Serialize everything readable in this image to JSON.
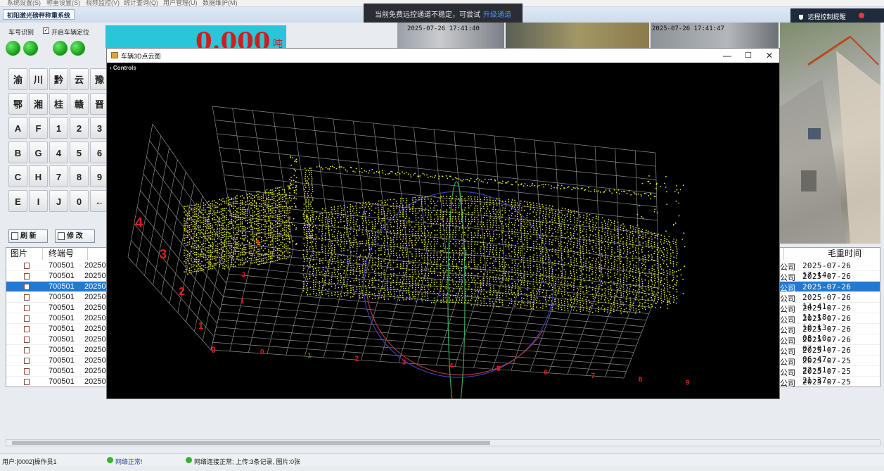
{
  "menubar": {
    "items": [
      "系统设置(S)",
      "称重设置(S)",
      "视频监控(V)",
      "统计查询(Q)",
      "用户管理(U)",
      "数据维护(M)"
    ]
  },
  "app": {
    "title": "初阳激光磅秤称重系统"
  },
  "toast": {
    "message": "当前免费远控通道不稳定，可尝试",
    "link": "升级通道"
  },
  "remote": {
    "label": "远程控制提醒"
  },
  "left": {
    "plate_label": "车号识别",
    "locate_label": "开启车辆定位",
    "weight_value": "0.000",
    "weight_unit": "吨",
    "keys": [
      [
        "渝",
        "川",
        "黔",
        "云",
        "豫"
      ],
      [
        "鄂",
        "湘",
        "桂",
        "赣",
        "晋"
      ],
      [
        "A",
        "F",
        "1",
        "2",
        "3"
      ],
      [
        "B",
        "G",
        "4",
        "5",
        "6"
      ],
      [
        "C",
        "H",
        "7",
        "8",
        "9"
      ],
      [
        "E",
        "I",
        "J",
        "0",
        "←"
      ]
    ],
    "refresh_label": "刷  新",
    "edit_label": "修  改"
  },
  "cameras": [
    {
      "timestamp": "2025-07-26  17:41:40"
    },
    {
      "timestamp": "2025-07-26  17:41:47"
    }
  ],
  "popup": {
    "title": "车辆3D点云图",
    "controls_label": "Controls",
    "minimize": "—",
    "maximize": "☐",
    "close": "✕",
    "axis_y_ticks": [
      "0",
      "1",
      "2",
      "3",
      "4"
    ],
    "axis_x_ticks": [
      "0",
      "1",
      "2",
      "3",
      "4",
      "5",
      "6",
      "7",
      "8",
      "9"
    ],
    "axis_z_ticks": [
      "1",
      "2",
      "3"
    ]
  },
  "grid": {
    "headers": [
      "图片",
      "终端号",
      "毛重时间"
    ],
    "rows": [
      {
        "terminal": "700501",
        "code": "20250",
        "company": "公司",
        "time": "2025-07-26 17:14:"
      },
      {
        "terminal": "700501",
        "code": "20250",
        "company": "公司",
        "time": "2025-07-26 16:15:"
      },
      {
        "terminal": "700501",
        "code": "20250",
        "company": "公司",
        "time": "2025-07-26 16:08:"
      },
      {
        "terminal": "700501",
        "code": "20250",
        "company": "公司",
        "time": "2025-07-26 14:41:"
      },
      {
        "terminal": "700501",
        "code": "20250",
        "company": "公司",
        "time": "2025-07-26 11:18:"
      },
      {
        "terminal": "700501",
        "code": "20250",
        "company": "公司",
        "time": "2025-07-26 10:13:"
      },
      {
        "terminal": "700501",
        "code": "20250",
        "company": "公司",
        "time": "2025-07-26 08:10:"
      },
      {
        "terminal": "700501",
        "code": "20250",
        "company": "公司",
        "time": "2025-07-26 07:01:"
      },
      {
        "terminal": "700501",
        "code": "20250",
        "company": "公司",
        "time": "2025-07-26 06:47:"
      },
      {
        "terminal": "700501",
        "code": "20250",
        "company": "公司",
        "time": "2025-07-25 22:31:"
      },
      {
        "terminal": "700501",
        "code": "20250",
        "company": "公司",
        "time": "2025-07-25 21:37:"
      },
      {
        "terminal": "700501",
        "code": "20250",
        "company": "公司",
        "time": "2025-07-25 21:27:"
      }
    ],
    "selected_index": 2
  },
  "status": {
    "user": "用户:[0002]操作员1",
    "network": "网络正常!",
    "connection": "网络连接正常; 上传:3条记录, 图片:0张"
  },
  "colors": {
    "points": "#e8e82a",
    "grid_lines": "#8a8a8a",
    "axis_labels": "#e02020",
    "selection": "#1f7ad6"
  }
}
